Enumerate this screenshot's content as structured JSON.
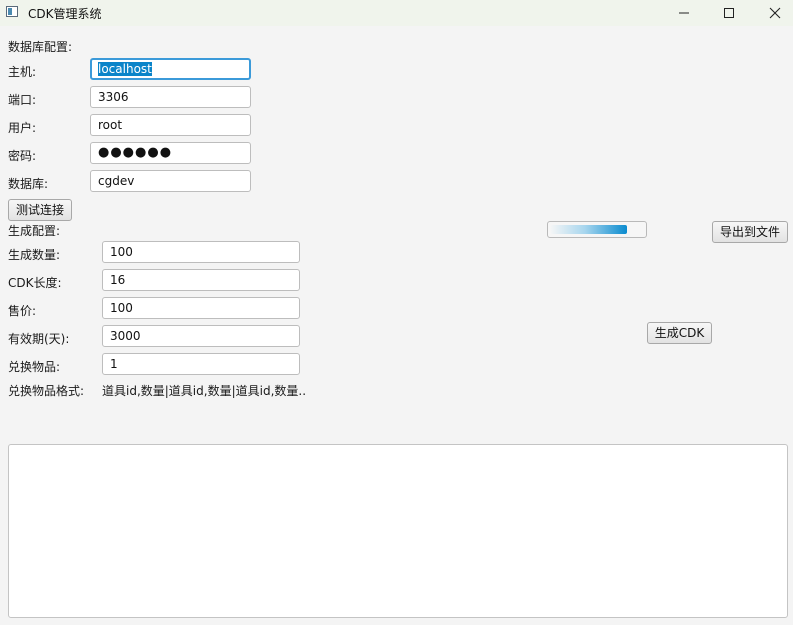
{
  "window": {
    "title": "CDK管理系统",
    "icons": {
      "app": "app-window-icon",
      "minimize": "minimize-icon",
      "maximize": "maximize-icon",
      "close": "close-icon"
    }
  },
  "db": {
    "section_label": "数据库配置:",
    "host_label": "主机:",
    "host_value": "localhost",
    "port_label": "端口:",
    "port_value": "3306",
    "user_label": "用户:",
    "user_value": "root",
    "password_label": "密码:",
    "password_masked": "●●●●●●",
    "database_label": "数据库:",
    "database_value": "cgdev",
    "test_button": "测试连接"
  },
  "gen": {
    "section_label": "生成配置:",
    "count_label": "生成数量:",
    "count_value": "100",
    "length_label": "CDK长度:",
    "length_value": "16",
    "price_label": "售价:",
    "price_value": "100",
    "validity_label": "有效期(天):",
    "validity_value": "3000",
    "items_label": "兑换物品:",
    "items_value": "1",
    "format_label": "兑换物品格式:",
    "format_value": "道具id,数量|道具id,数量|道具id,数量..",
    "generate_button": "生成CDK"
  },
  "export": {
    "button": "导出到文件",
    "progress": 0.82
  },
  "log": {
    "text": ""
  }
}
